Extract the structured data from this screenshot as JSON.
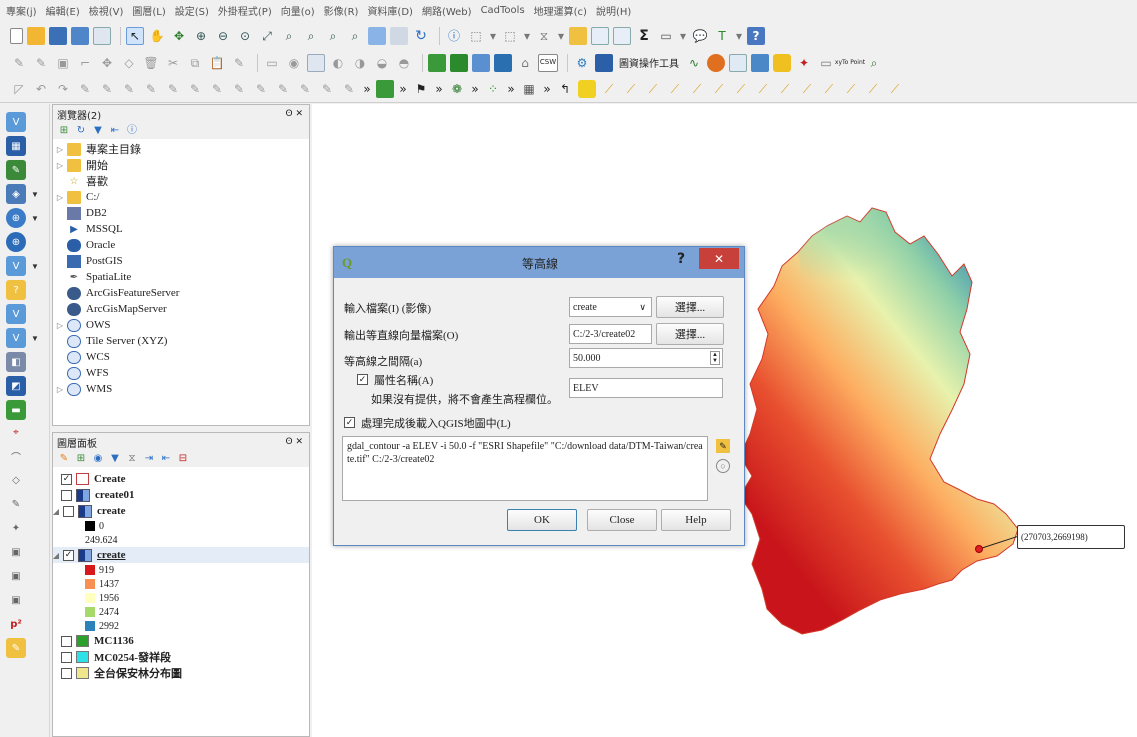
{
  "menu": [
    "專案(j)",
    "編輯(E)",
    "檢視(V)",
    "圖層(L)",
    "設定(S)",
    "外掛程式(P)",
    "向量(o)",
    "影像(R)",
    "資料庫(D)",
    "網路(Web)",
    "CadTools",
    "地理運算(c)",
    "說明(H)"
  ],
  "toolbar": {
    "sigma": "Σ",
    "csw": "CSW",
    "table_ops_label": "圖資操作工具",
    "point_tool": "xyTo Point"
  },
  "browser": {
    "title": "瀏覽器(2)",
    "items": [
      {
        "label": "專案主目錄",
        "icon": "folder-icon"
      },
      {
        "label": "開始",
        "icon": "folder-icon"
      },
      {
        "label": "喜歡",
        "icon": "star-icon"
      },
      {
        "label": "C:/",
        "icon": "folder-icon"
      },
      {
        "label": "DB2",
        "icon": "db2-icon"
      },
      {
        "label": "MSSQL",
        "icon": "mssql-icon"
      },
      {
        "label": "Oracle",
        "icon": "oracle-icon"
      },
      {
        "label": "PostGIS",
        "icon": "postgis-icon"
      },
      {
        "label": "SpatiaLite",
        "icon": "spatialite-icon"
      },
      {
        "label": "ArcGisFeatureServer",
        "icon": "arcgis-icon"
      },
      {
        "label": "ArcGisMapServer",
        "icon": "arcgis-icon"
      },
      {
        "label": "OWS",
        "icon": "globe-icon"
      },
      {
        "label": "Tile Server (XYZ)",
        "icon": "globe-icon"
      },
      {
        "label": "WCS",
        "icon": "globe-icon"
      },
      {
        "label": "WFS",
        "icon": "globe-icon"
      },
      {
        "label": "WMS",
        "icon": "globe-icon"
      }
    ]
  },
  "layers": {
    "title": "圖層面板",
    "items": [
      {
        "label": "Create",
        "checked": true
      },
      {
        "label": "create01",
        "checked": false
      },
      {
        "label": "create",
        "checked": false
      },
      {
        "label": "create",
        "checked": true
      },
      {
        "label": "MC1136",
        "checked": false
      },
      {
        "label": "MC0254-發祥段",
        "checked": false
      },
      {
        "label": "全台保安林分布圖",
        "checked": false
      }
    ],
    "legend_gray": [
      {
        "label": "0",
        "color": "#000000"
      },
      {
        "label": "249.624",
        "color": null
      }
    ],
    "legend_color": [
      {
        "label": "919",
        "color": "#d7191c"
      },
      {
        "label": "1437",
        "color": "#f69053"
      },
      {
        "label": "1956",
        "color": "#ffffbf"
      },
      {
        "label": "2474",
        "color": "#a6d96a"
      },
      {
        "label": "2992",
        "color": "#2b83ba"
      }
    ],
    "swatch_colors": [
      "#2ba02b",
      "#2ee0e8",
      "#f0e68c"
    ]
  },
  "map": {
    "coordinate_label": "(270703,2669198)"
  },
  "dialog": {
    "title": "等高線",
    "help": "?",
    "close": "✕",
    "input_label": "輸入檔案(I) (影像)",
    "input_value": "create",
    "browse_label": "選擇...",
    "output_label": "輸出等直線向量檔案(O)",
    "output_value": "C:/2-3/create02",
    "interval_label": "等高線之間隔(a)",
    "interval_value": "50.000",
    "attr_label": "屬性名稱(A)",
    "attr_note": "如果沒有提供，將不會產生高程欄位。",
    "attr_value": "ELEV",
    "load_label": "處理完成後載入QGIS地圖中(L)",
    "command": "gdal_contour -a ELEV -i 50.0 -f \"ESRI Shapefile\" \"C:/download data/DTM-Taiwan/create.tif\" C:/2-3/create02",
    "ok": "OK",
    "close_btn": "Close",
    "help_btn": "Help"
  }
}
